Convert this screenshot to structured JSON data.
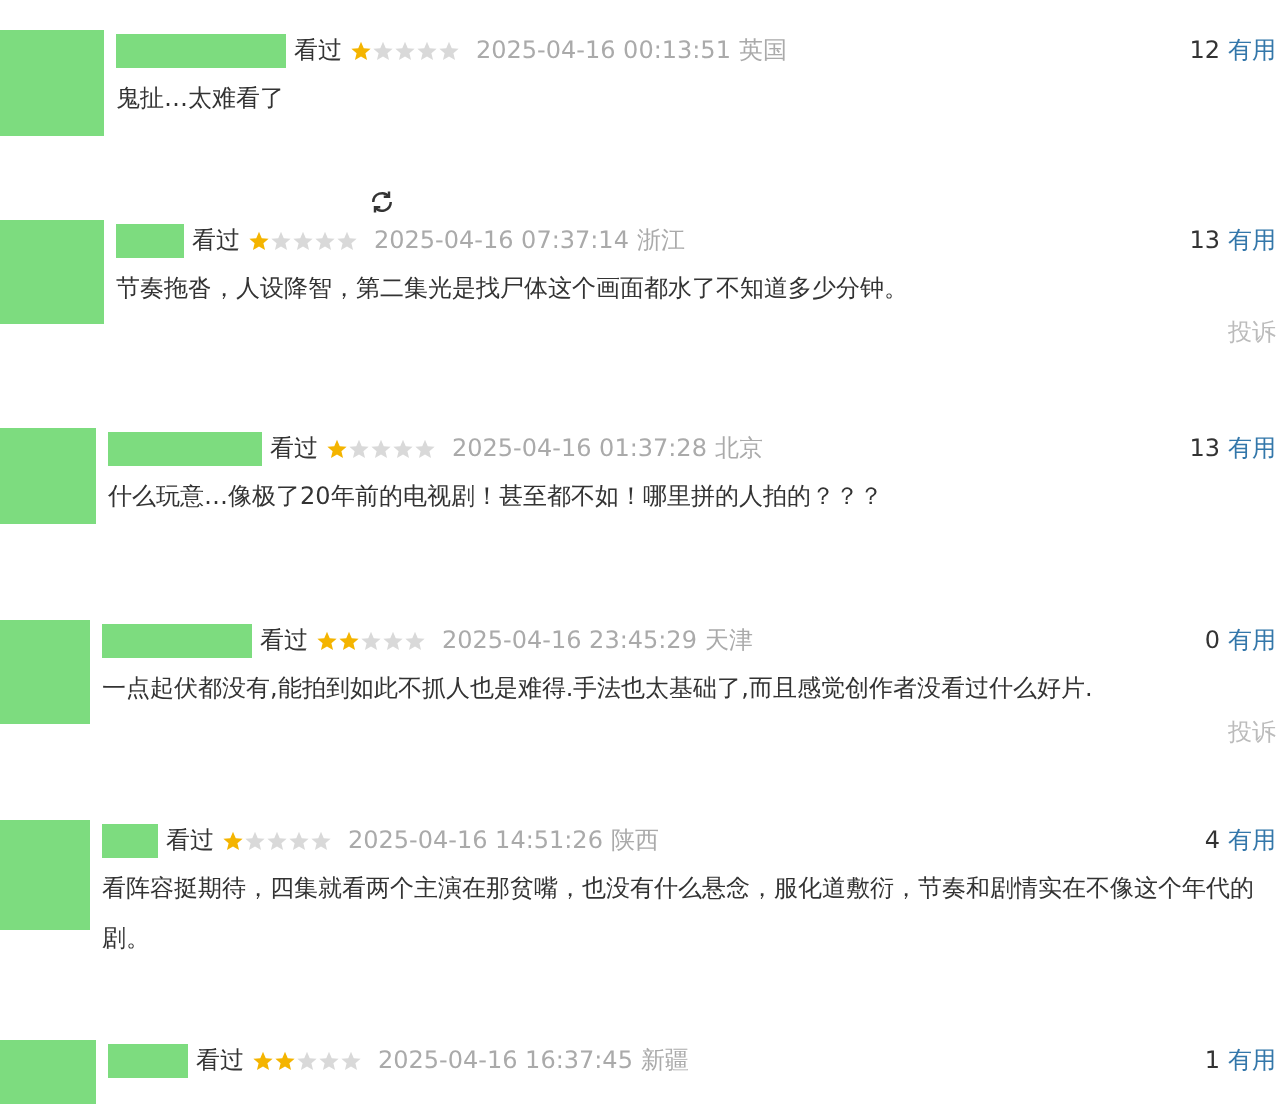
{
  "reviews": [
    {
      "status": "看过",
      "stars": 1,
      "time": "2025-04-16 00:13:51",
      "location": "英国",
      "votes": "12",
      "useful": "有用",
      "content": "鬼扯…太难看了"
    },
    {
      "status": "看过",
      "stars": 1,
      "time": "2025-04-16 07:37:14",
      "location": "浙江",
      "votes": "13",
      "useful": "有用",
      "content": "节奏拖沓，人设降智，第二集光是找尸体这个画面都水了不知道多少分钟。",
      "report": "投诉"
    },
    {
      "status": "看过",
      "stars": 1,
      "time": "2025-04-16 01:37:28",
      "location": "北京",
      "votes": "13",
      "useful": "有用",
      "content": "什么玩意…像极了20年前的电视剧！甚至都不如！哪里拼的人拍的？？？"
    },
    {
      "status": "看过",
      "stars": 2,
      "time": "2025-04-16 23:45:29",
      "location": "天津",
      "votes": "0",
      "useful": "有用",
      "content": "一点起伏都没有,能拍到如此不抓人也是难得.手法也太基础了,而且感觉创作者没看过什么好片.",
      "report": "投诉"
    },
    {
      "status": "看过",
      "stars": 1,
      "time": "2025-04-16 14:51:26",
      "location": "陕西",
      "votes": "4",
      "useful": "有用",
      "content": "看阵容挺期待，四集就看两个主演在那贫嘴，也没有什么悬念，服化道敷衍，节奏和剧情实在不像这个年代的剧。"
    },
    {
      "status": "看过",
      "stars": 2,
      "time": "2025-04-16 16:37:45",
      "location": "新疆",
      "votes": "1",
      "useful": "有用"
    }
  ]
}
